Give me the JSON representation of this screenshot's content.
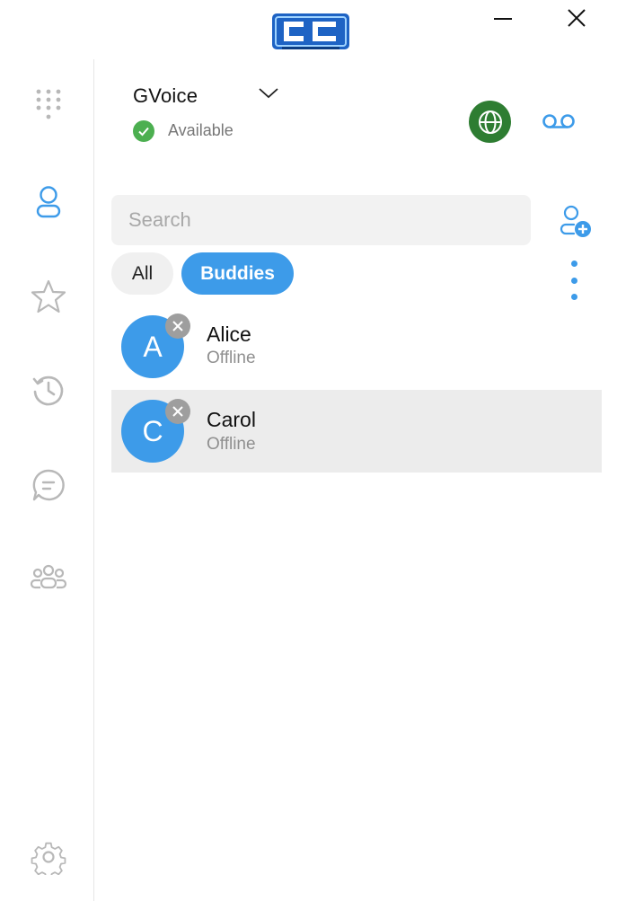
{
  "titlebar": {
    "logo_icon": "cc-logo",
    "minimize_icon": "minimize-icon",
    "close_icon": "close-icon"
  },
  "sidebar": {
    "items": [
      {
        "icon": "dialpad-icon",
        "active": false
      },
      {
        "icon": "contacts-icon",
        "active": true
      },
      {
        "icon": "star-icon",
        "active": false
      },
      {
        "icon": "history-icon",
        "active": false
      },
      {
        "icon": "chat-icon",
        "active": false
      },
      {
        "icon": "group-icon",
        "active": false
      }
    ],
    "settings_icon": "gear-icon"
  },
  "header": {
    "account_name": "GVoice",
    "status_text": "Available",
    "status_color": "#4caf50"
  },
  "search": {
    "placeholder": "Search",
    "value": ""
  },
  "filters": {
    "all_label": "All",
    "buddies_label": "Buddies",
    "selected": "Buddies"
  },
  "contacts": [
    {
      "initial": "A",
      "name": "Alice",
      "status": "Offline",
      "selected": false
    },
    {
      "initial": "C",
      "name": "Carol",
      "status": "Offline",
      "selected": true
    }
  ],
  "colors": {
    "accent": "#3d9be9",
    "globe_bg": "#2e7d32",
    "selected_row": "#ececec",
    "icon_gray": "#b8b8b8"
  }
}
